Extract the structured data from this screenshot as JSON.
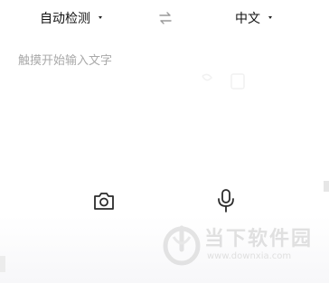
{
  "language_bar": {
    "source_language": "自动检测",
    "target_language": "中文",
    "swap_icon": "swap-arrows-icon",
    "caret_icon": "caret-down-icon"
  },
  "input": {
    "placeholder": "触摸开始输入文字",
    "value": ""
  },
  "toolbar": {
    "camera_icon": "camera-icon",
    "mic_icon": "microphone-icon"
  },
  "watermark": {
    "title": "当下软件园",
    "url": "www.downxia.com"
  },
  "colors": {
    "background": "#ffffff",
    "text": "#111111",
    "placeholder": "#a9a9a9",
    "icon": "#2b2b2b",
    "watermark": "#c9c9c9"
  }
}
